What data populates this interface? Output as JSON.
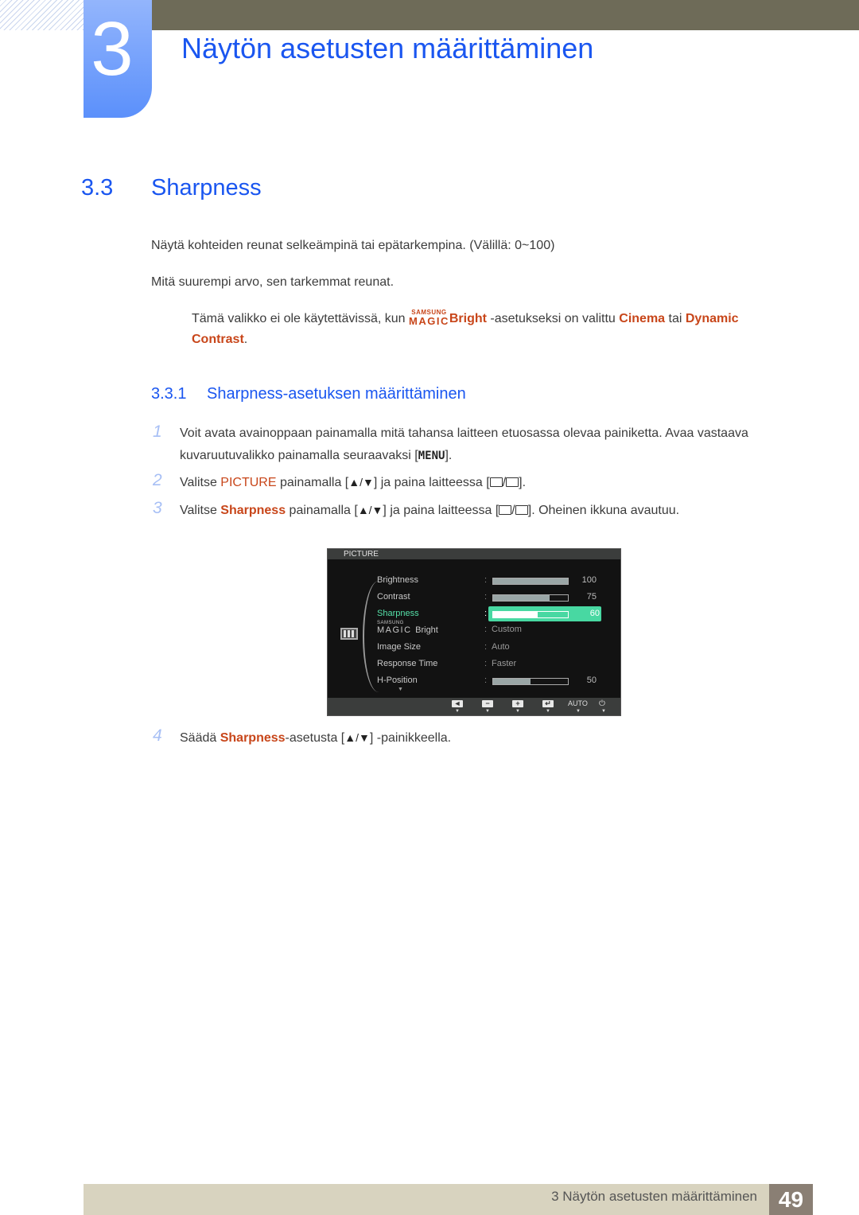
{
  "chapter": {
    "number": "3",
    "title": "Näytön asetusten määrittäminen"
  },
  "section": {
    "number": "3.3",
    "title": "Sharpness",
    "para1": "Näytä kohteiden reunat selkeämpinä tai epätarkempina. (Välillä: 0~100)",
    "para2": "Mitä suurempi arvo, sen tarkemmat reunat.",
    "note": {
      "pre": "Tämä valikko ei ole käytettävissä, kun ",
      "magic_small": "SAMSUNG",
      "magic_big": "MAGIC",
      "bright": "Bright",
      "mid": " -asetukseksi on valittu ",
      "cinema": "Cinema",
      "tai": " tai ",
      "dynamic": "Dynamic",
      "contrast": "Contrast",
      "end": "."
    }
  },
  "subsection": {
    "number": "3.3.1",
    "title": "Sharpness-asetuksen määrittäminen"
  },
  "steps": [
    {
      "num": "1",
      "line1": "Voit avata avainoppaan painamalla mitä tahansa laitteen etuosassa olevaa painiketta. Avaa vastaava",
      "line2_pre": "kuvaruutuvalikko painamalla seuraavaksi [",
      "menu": "MENU",
      "line2_post": "]."
    },
    {
      "num": "2",
      "pre": "Valitse ",
      "highlight": "PICTURE",
      "mid": " painamalla [",
      "arrows": "▲/▼",
      "mid2": "] ja paina laitteessa [",
      "slash": "/",
      "post": "]."
    },
    {
      "num": "3",
      "pre": "Valitse ",
      "highlight": "Sharpness",
      "mid": " painamalla [",
      "arrows": "▲/▼",
      "mid2": "] ja paina laitteessa [",
      "slash": "/",
      "post": "]. Oheinen ikkuna avautuu."
    },
    {
      "num": "4",
      "pre": "Säädä ",
      "highlight": "Sharpness",
      "mid": "-asetusta [",
      "arrows": "▲/▼",
      "post": "] -painikkeella."
    }
  ],
  "osd": {
    "title": "PICTURE",
    "rows": [
      {
        "label": "Brightness",
        "type": "bar",
        "value": 100,
        "display": "100"
      },
      {
        "label": "Contrast",
        "type": "bar",
        "value": 75,
        "display": "75"
      },
      {
        "label": "Sharpness",
        "type": "bar",
        "value": 60,
        "display": "60",
        "selected": true
      },
      {
        "label_small": "SAMSUNG",
        "label_big": "MAGIC",
        "label": "Bright",
        "type": "text",
        "display": "Custom"
      },
      {
        "label": "Image Size",
        "type": "text",
        "display": "Auto"
      },
      {
        "label": "Response Time",
        "type": "text",
        "display": "Faster"
      },
      {
        "label": "H-Position",
        "type": "bar",
        "value": 50,
        "display": "50"
      }
    ],
    "more_indicator": "▼",
    "buttons": {
      "left": "◄",
      "minus": "−",
      "plus": "+",
      "enter": "↵",
      "auto": "AUTO",
      "power": "⏻",
      "arrow": "▼"
    }
  },
  "footer": {
    "text": "3 Näytön asetusten määrittäminen",
    "page": "49"
  }
}
